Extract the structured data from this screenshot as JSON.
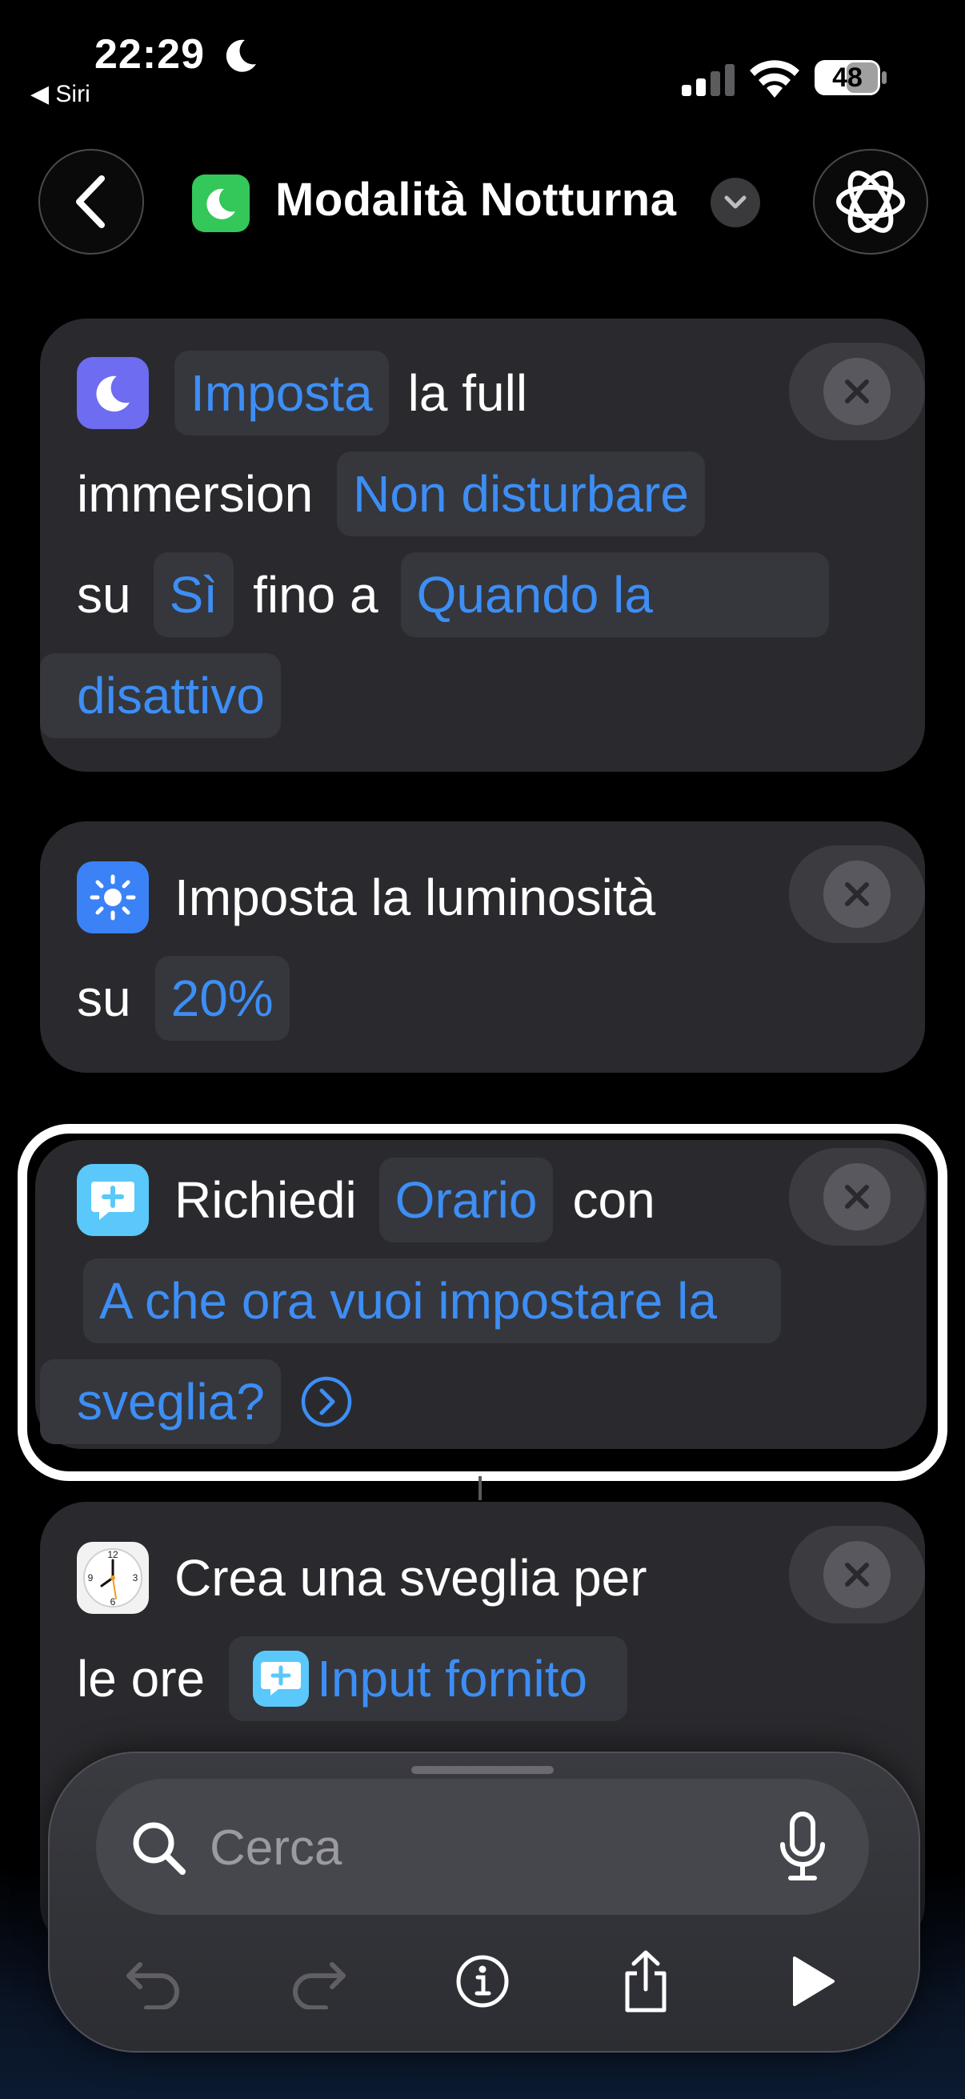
{
  "status_bar": {
    "time": "22:29",
    "back_app": "◀ Siri",
    "battery": "48"
  },
  "header": {
    "title": "Modalità Notturna"
  },
  "actions": [
    {
      "icon": "moon-icon",
      "color": "#6e6cf0",
      "param_action": "Imposta",
      "text1": "la full",
      "text2": "immersion",
      "param_focus": "Non disturbare",
      "text3": "su",
      "param_state": "Sì",
      "text4": "fino a",
      "param_until_1": "Quando la",
      "param_until_2": "disattivo"
    },
    {
      "icon": "sun-icon",
      "color": "#3b82f6",
      "text1": "Imposta la luminosità",
      "text2": "su",
      "param_value": "20%"
    },
    {
      "icon": "ask-input-icon",
      "color": "#5ac8fa",
      "text1": "Richiedi",
      "param_type": "Orario",
      "text2": "con",
      "param_prompt_1": "A che ora vuoi impostare la",
      "param_prompt_2": "sveglia?"
    },
    {
      "icon": "clock-icon",
      "text1": "Crea una sveglia per",
      "text2": "le ore",
      "param_input": "Input fornito"
    }
  ],
  "toolbar": {
    "search_placeholder": "Cerca"
  },
  "colors": {
    "accent": "#3d8ef5",
    "card": "#2a2a2e",
    "token": "#35373d"
  }
}
